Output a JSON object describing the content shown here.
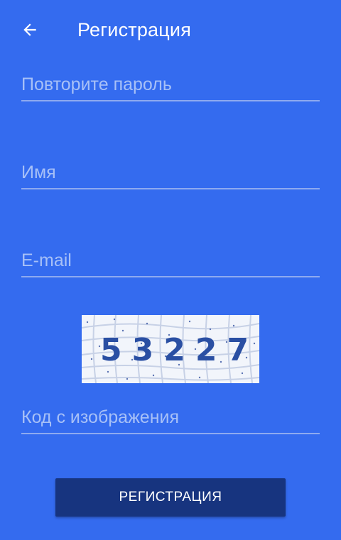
{
  "header": {
    "back_icon": "arrow-left-icon",
    "title": "Регистрация"
  },
  "form": {
    "repeat_password": {
      "placeholder": "Повторите пароль",
      "value": ""
    },
    "name": {
      "placeholder": "Имя",
      "value": ""
    },
    "email": {
      "placeholder": "E-mail",
      "value": ""
    },
    "captcha_image": {
      "digits": "53227"
    },
    "captcha_code": {
      "placeholder": "Код с изображения",
      "value": ""
    },
    "submit_label": "РЕГИСТРАЦИЯ"
  },
  "colors": {
    "background": "#346bef",
    "underline": "#8eaaf0",
    "placeholder": "#a7c0f7",
    "button": "#17347f",
    "captcha_text": "#2a4fa3"
  }
}
